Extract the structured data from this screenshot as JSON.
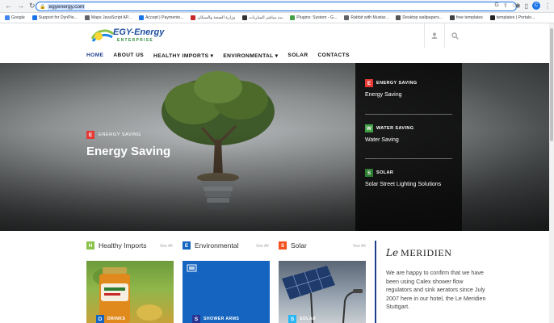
{
  "browser": {
    "url": "egyenergy.com",
    "profile_initial": "C"
  },
  "bookmarks": [
    {
      "label": "Google",
      "color": "#4285f4"
    },
    {
      "label": "Support for DynPie...",
      "color": "#1a73e8"
    },
    {
      "label": "Maps JavaScript AP...",
      "color": "#5f6368"
    },
    {
      "label": "Accept | Payments...",
      "color": "#1a73e8"
    },
    {
      "label": "وزارة الصحة والسكان",
      "color": "#c62828"
    },
    {
      "label": "بث مباشر المباريات",
      "color": "#333333"
    },
    {
      "label": "Plugins: System - G...",
      "color": "#43a047"
    },
    {
      "label": "Rabbit with Mustar...",
      "color": "#5f6368"
    },
    {
      "label": "Desktop wallpapers...",
      "color": "#555555"
    },
    {
      "label": "free templates",
      "color": "#3c4043"
    },
    {
      "label": "templates | Portalo...",
      "color": "#222222"
    }
  ],
  "logo": {
    "title": "EGY-Energy",
    "subtitle": "ENTERPRISE"
  },
  "menu": [
    {
      "label": "HOME",
      "active": true
    },
    {
      "label": "ABOUT US",
      "active": false
    },
    {
      "label": "HEALTHY IMPORTS ▾",
      "active": false
    },
    {
      "label": "ENVIRONMENTAL ▾",
      "active": false
    },
    {
      "label": "SOLAR",
      "active": false
    },
    {
      "label": "CONTACTS",
      "active": false
    }
  ],
  "hero": {
    "badge": "E",
    "badge_color": "#e53935",
    "category": "ENERGY SAVING",
    "title": "Energy Saving"
  },
  "side_panel": [
    {
      "badge": "E",
      "color": "#e53935",
      "category": "ENERGY SAVING",
      "title": "Energy Saving"
    },
    {
      "badge": "W",
      "color": "#43a047",
      "category": "WATER SAVING",
      "title": "Water Saving"
    },
    {
      "badge": "S",
      "color": "#2e7d32",
      "category": "SOLAR",
      "title": "Solar Street Lighting Solutions"
    }
  ],
  "sections": [
    {
      "badge": "H",
      "color": "#8bc34a",
      "label": "Healthy Imports",
      "see_all": "See All",
      "card_badge": "D",
      "card_badge_color": "#1565c0",
      "card_category": "DRINKS"
    },
    {
      "badge": "E",
      "color": "#1565c0",
      "label": "Environmental",
      "see_all": "See All",
      "card_badge": "S",
      "card_badge_color": "#283593",
      "card_category": "SHOWER ARMS"
    },
    {
      "badge": "S",
      "color": "#f4511e",
      "label": "Solar",
      "see_all": "See All",
      "card_badge": "S",
      "card_badge_color": "#29b6f6",
      "card_category": "SOLAR"
    }
  ],
  "aside": {
    "logo_script": "Le",
    "logo_name": "MERIDIEN",
    "quote": "We are happy to confirm that we have been using Calex shower flow regulators and sink aerators since July 2007 here in our hotel, the Le Meridien Stuttgart."
  }
}
